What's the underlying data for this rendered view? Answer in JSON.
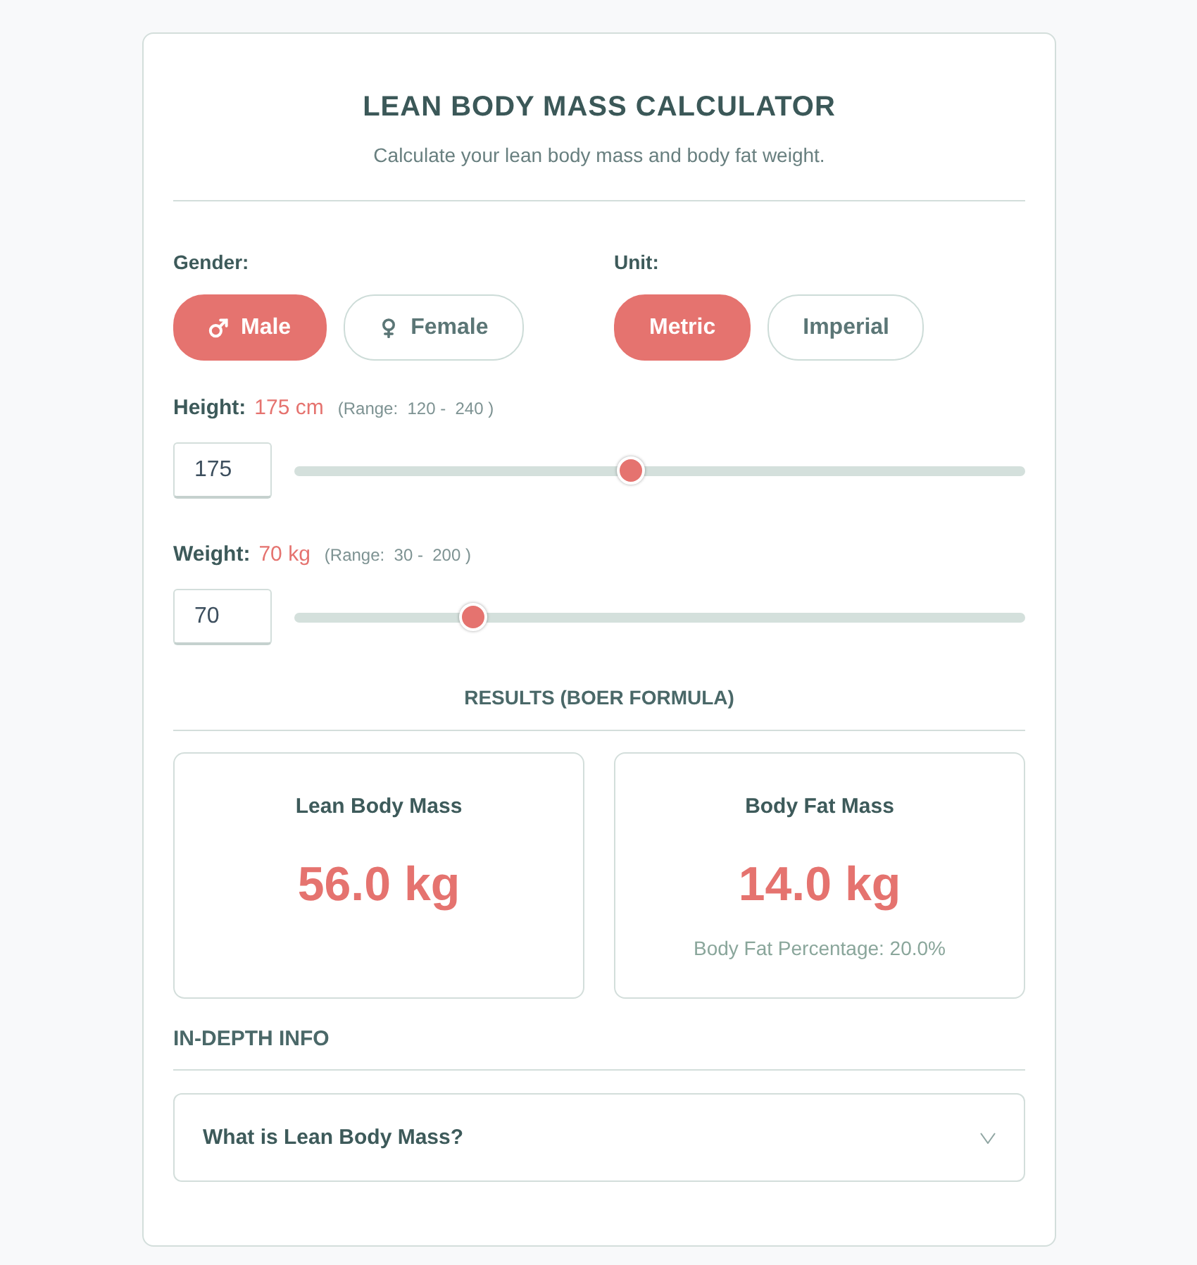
{
  "header": {
    "title": "LEAN BODY MASS CALCULATOR",
    "subtitle": "Calculate your lean body mass and body fat weight."
  },
  "option_groups": [
    {
      "label": "Gender:",
      "options": [
        {
          "label": "Male",
          "kind": "male",
          "selected": true
        },
        {
          "label": "Female",
          "kind": "female",
          "selected": false
        }
      ]
    },
    {
      "label": "Unit:",
      "options": [
        {
          "label": "Metric",
          "kind": "text",
          "selected": true
        },
        {
          "label": "Imperial",
          "kind": "text",
          "selected": false
        }
      ]
    }
  ],
  "measurements": [
    {
      "label": "Height:",
      "reading": "175 cm",
      "range": "(Range:  120 -  240 )",
      "value": "175",
      "level": 0.458
    },
    {
      "label": "Weight:",
      "reading": "70 kg",
      "range": "(Range:  30 -  200 )",
      "value": "70",
      "level": 0.235
    }
  ],
  "results": {
    "heading": "RESULTS (BOER FORMULA)",
    "cards": [
      {
        "title": "Lean Body Mass",
        "value": "56.0 kg"
      },
      {
        "title": "Body Fat Mass",
        "value": "14.0 kg",
        "note": "Body Fat Percentage: 20.0%"
      }
    ]
  },
  "info": {
    "heading": "IN-DEPTH INFO",
    "items": [
      {
        "question": "What is Lean Body Mass?",
        "expanded": false
      }
    ]
  }
}
